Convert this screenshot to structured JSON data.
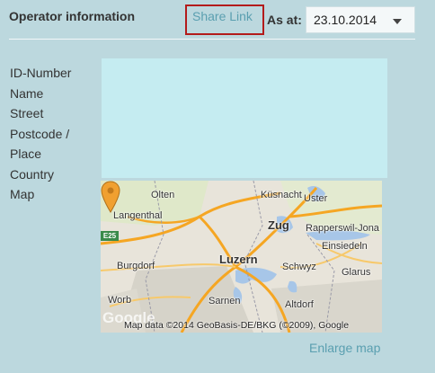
{
  "header": {
    "title": "Operator information",
    "share_link": "Share Link",
    "as_at_label": "As at:",
    "date_value": "23.10.2014"
  },
  "fields": {
    "labels": [
      "ID-Number",
      "Name",
      "Street",
      "Postcode /",
      "Place",
      "Country",
      "Map"
    ]
  },
  "map": {
    "places": {
      "olten": "Olten",
      "kusnacht": "Küsnacht",
      "uster": "Uster",
      "langenthal": "Langenthal",
      "zug": "Zug",
      "rapperswil": "Rapperswil-Jona",
      "einsiedeln": "Einsiedeln",
      "burgdorf": "Burgdorf",
      "luzern": "Luzern",
      "schwyz": "Schwyz",
      "glarus": "Glarus",
      "worb": "Worb",
      "sarnen": "Sarnen",
      "altdorf": "Altdorf"
    },
    "road_badge": "E25",
    "watermark": "Google",
    "attribution": "Map data ©2014 GeoBasis-DE/BKG (©2009), Google"
  },
  "links": {
    "enlarge_map": "Enlarge map"
  }
}
